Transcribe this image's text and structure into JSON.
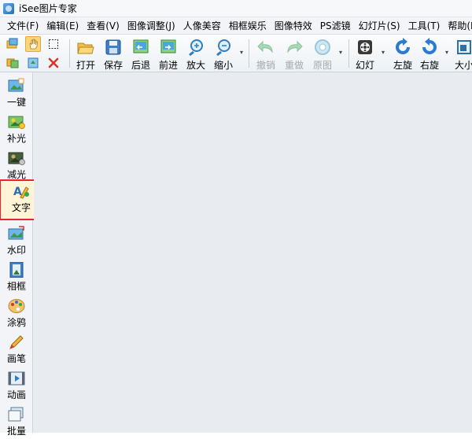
{
  "app": {
    "title": "iSee图片专家"
  },
  "menu": [
    "文件(F)",
    "编辑(E)",
    "查看(V)",
    "图像调整(J)",
    "人像美容",
    "相框娱乐",
    "图像特效",
    "PS滤镜",
    "幻灯片(S)",
    "工具(T)",
    "帮助(H)"
  ],
  "toolbar": {
    "open": "打开",
    "save": "保存",
    "back": "后退",
    "forward": "前进",
    "zoom_in": "放大",
    "zoom_out": "缩小",
    "undo": "撤销",
    "redo": "重做",
    "original": "原图",
    "slideshow": "幻灯",
    "rotate_left": "左旋",
    "rotate_right": "右旋",
    "size": "大小"
  },
  "sidebar": {
    "items": [
      {
        "label": "一键"
      },
      {
        "label": "补光"
      },
      {
        "label": "减光"
      },
      {
        "label": "文字"
      },
      {
        "label": "水印"
      },
      {
        "label": "相框"
      },
      {
        "label": "涂鸦"
      },
      {
        "label": "画笔"
      },
      {
        "label": "动画"
      },
      {
        "label": "批量"
      }
    ]
  },
  "colors": {
    "highlight_border": "#e8252b",
    "accent_blue": "#2a7bd5",
    "green": "#2fa84f"
  }
}
